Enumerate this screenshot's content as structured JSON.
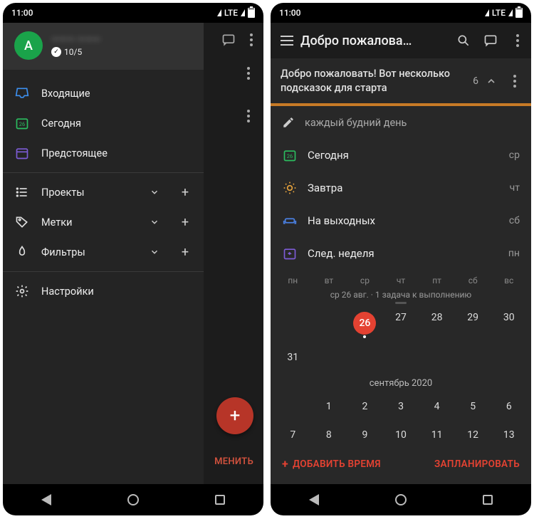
{
  "status": {
    "time": "11:00",
    "net": "LTE"
  },
  "left": {
    "profile": {
      "initial": "A",
      "name": "——— ———",
      "karma_check": "✓",
      "karma": "10/5"
    },
    "nav": {
      "inbox": "Входящие",
      "today": "Сегодня",
      "upcoming": "Предстоящее",
      "projects": "Проекты",
      "labels": "Метки",
      "filters": "Фильтры",
      "settings": "Настройки"
    },
    "fab_edit": "МЕНИТЬ"
  },
  "right": {
    "title": "Добро пожалова…",
    "banner": {
      "text": "Добро пожаловать! Вот несколько подсказок для старта",
      "count": "6"
    },
    "input_placeholder": "каждый будний день",
    "options": {
      "today": {
        "label": "Сегодня",
        "day": "ср"
      },
      "tomorrow": {
        "label": "Завтра",
        "day": "чт"
      },
      "weekend": {
        "label": "На выходных",
        "day": "сб"
      },
      "nextweek": {
        "label": "След. неделя",
        "day": "пн"
      }
    },
    "cal": {
      "dow": [
        "пн",
        "вт",
        "ср",
        "чт",
        "пт",
        "сб",
        "вс"
      ],
      "sub": "ср 26 авг. · 1 задача к выполнению",
      "row1": [
        "",
        "",
        "26",
        "27",
        "28",
        "29",
        "30"
      ],
      "today_index": 2,
      "row1_last": "31",
      "month": "сентябрь 2020",
      "row2": [
        "",
        "1",
        "2",
        "3",
        "4",
        "5",
        "6"
      ],
      "row3": [
        "7",
        "8",
        "9",
        "10",
        "11",
        "12",
        "13"
      ]
    },
    "actions": {
      "add_time": "ДОБАВИТЬ ВРЕМЯ",
      "schedule": "ЗАПЛАНИРОВАТЬ"
    }
  }
}
